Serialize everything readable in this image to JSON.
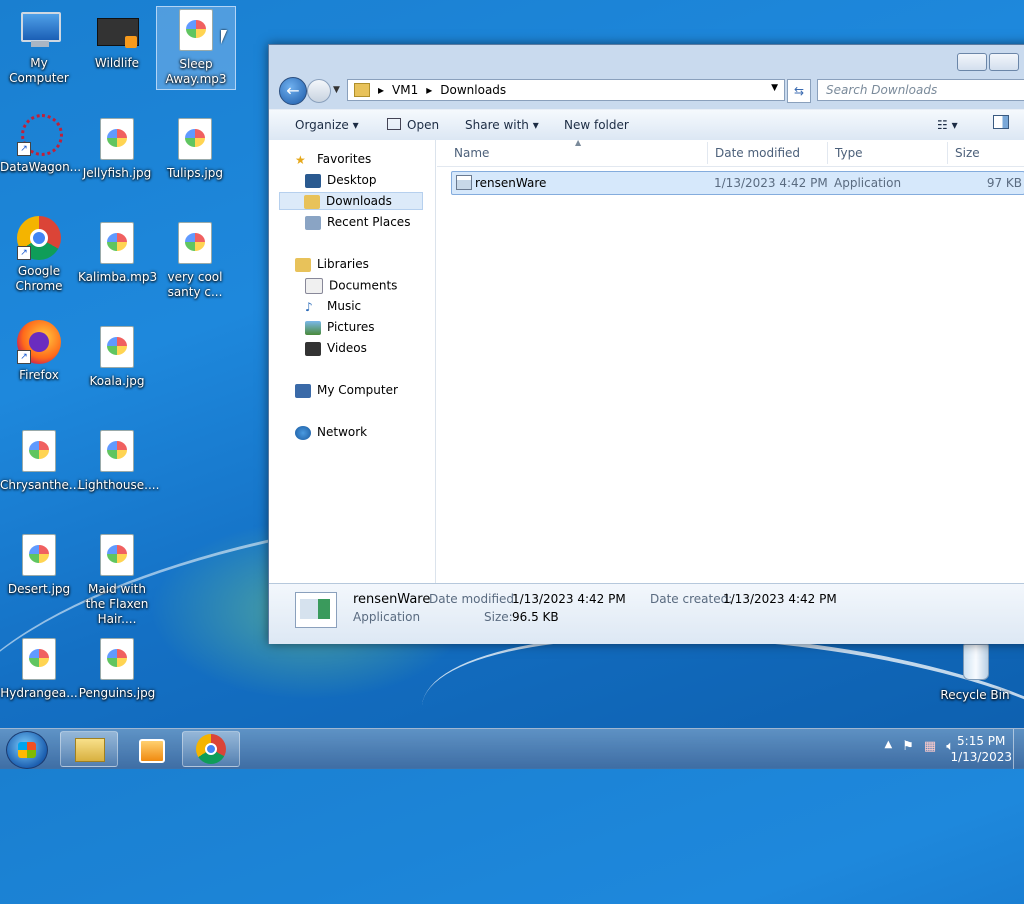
{
  "desktop": {
    "icons": [
      {
        "label": "My Computer"
      },
      {
        "label": "Wildlife"
      },
      {
        "label": "Sleep Away.mp3"
      },
      {
        "label": "DataWagon..."
      },
      {
        "label": "Jellyfish.jpg"
      },
      {
        "label": "Tulips.jpg"
      },
      {
        "label": "Google Chrome"
      },
      {
        "label": "Kalimba.mp3"
      },
      {
        "label": "very cool santy c..."
      },
      {
        "label": "Firefox"
      },
      {
        "label": "Koala.jpg"
      },
      {
        "label": "Chrysanthe..."
      },
      {
        "label": "Lighthouse...."
      },
      {
        "label": "Desert.jpg"
      },
      {
        "label": "Maid with the Flaxen Hair...."
      },
      {
        "label": "Hydrangea..."
      },
      {
        "label": "Penguins.jpg"
      },
      {
        "label": "Recycle Bin"
      }
    ]
  },
  "explorer": {
    "breadcrumb": [
      "VM1",
      "Downloads"
    ],
    "search_placeholder": "Search Downloads",
    "toolbar": {
      "organize": "Organize",
      "open": "Open",
      "share_with": "Share with",
      "new_folder": "New folder"
    },
    "nav": {
      "favorites": "Favorites",
      "desktop": "Desktop",
      "downloads": "Downloads",
      "recent": "Recent Places",
      "libraries": "Libraries",
      "documents": "Documents",
      "music": "Music",
      "pictures": "Pictures",
      "videos": "Videos",
      "computer": "My Computer",
      "network": "Network"
    },
    "columns": {
      "name": "Name",
      "date": "Date modified",
      "type": "Type",
      "size": "Size"
    },
    "files": [
      {
        "name": "rensenWare",
        "date": "1/13/2023 4:42 PM",
        "type": "Application",
        "size": "97 KB"
      }
    ],
    "details": {
      "name": "rensenWare",
      "kind": "Application",
      "date_modified_label": "Date modified:",
      "date_modified": "1/13/2023 4:42 PM",
      "date_created_label": "Date created:",
      "date_created": "1/13/2023 4:42 PM",
      "size_label": "Size:",
      "size": "96.5 KB"
    }
  },
  "taskbar": {
    "time": "5:15 PM",
    "date": "1/13/2023"
  }
}
